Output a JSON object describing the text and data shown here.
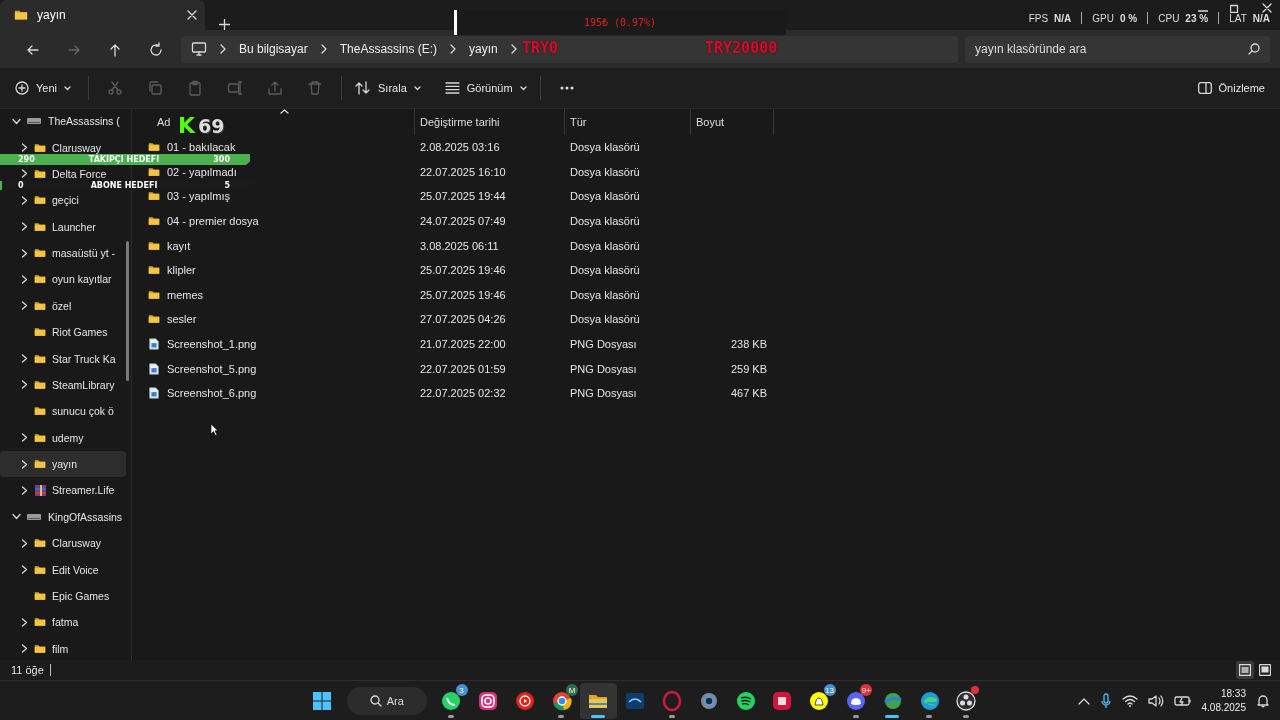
{
  "tab": {
    "title": "yayın",
    "selected": true
  },
  "perf": [
    {
      "label": "FPS",
      "value": "N/A"
    },
    {
      "label": "GPU",
      "value": "0 %"
    },
    {
      "label": "CPU",
      "value": "23 %"
    },
    {
      "label": "LAT",
      "value": "N/A"
    }
  ],
  "nav": [
    {
      "kind": "back",
      "disabled": false
    },
    {
      "kind": "forward",
      "disabled": true
    },
    {
      "kind": "up",
      "disabled": false
    },
    {
      "kind": "refresh",
      "disabled": false
    }
  ],
  "address": {
    "crumbs": [
      "Bu bilgisayar",
      "TheAssassins (E:)",
      "yayın"
    ]
  },
  "search": {
    "placeholder": "yayın klasöründe ara"
  },
  "toolbar": {
    "new": "Yeni",
    "sort": "Sırala",
    "view": "Görünüm",
    "preview": "Önizleme",
    "actions": [
      {
        "kind": "cut",
        "disabled": true
      },
      {
        "kind": "copy",
        "disabled": true
      },
      {
        "kind": "paste",
        "disabled": true
      },
      {
        "kind": "rename",
        "disabled": true
      },
      {
        "kind": "share",
        "disabled": true
      },
      {
        "kind": "delete",
        "disabled": true
      }
    ]
  },
  "sidebar": [
    {
      "label": "TheAssassins (",
      "kind": "drive",
      "expandable": true,
      "expanded": true,
      "selected": false,
      "children": [
        {
          "label": "Clarusway",
          "kind": "folder",
          "expandable": true,
          "expanded": false,
          "selected": false
        },
        {
          "label": "Delta Force",
          "kind": "folder",
          "expandable": true,
          "expanded": false,
          "selected": false
        },
        {
          "label": "geçici",
          "kind": "folder",
          "expandable": true,
          "expanded": false,
          "selected": false
        },
        {
          "label": "Launcher",
          "kind": "folder",
          "expandable": true,
          "expanded": false,
          "selected": false
        },
        {
          "label": "masaüstü yt -",
          "kind": "folder",
          "expandable": true,
          "expanded": false,
          "selected": false
        },
        {
          "label": "oyun kayıtlar",
          "kind": "folder",
          "expandable": true,
          "expanded": false,
          "selected": false
        },
        {
          "label": "özel",
          "kind": "folder",
          "expandable": true,
          "expanded": false,
          "selected": false
        },
        {
          "label": "Riot Games",
          "kind": "folder",
          "expandable": false,
          "selected": false
        },
        {
          "label": "Star Truck Ka",
          "kind": "folder",
          "expandable": true,
          "expanded": false,
          "selected": false
        },
        {
          "label": "SteamLibrary",
          "kind": "folder",
          "expandable": true,
          "expanded": false,
          "selected": false
        },
        {
          "label": "sunucu çok ö",
          "kind": "folder",
          "expandable": false,
          "selected": false
        },
        {
          "label": "udemy",
          "kind": "folder",
          "expandable": true,
          "expanded": false,
          "selected": false
        },
        {
          "label": "yayın",
          "kind": "folder",
          "expandable": true,
          "expanded": false,
          "selected": true
        },
        {
          "label": "Streamer.Life",
          "kind": "archive",
          "expandable": true,
          "expanded": false,
          "selected": false
        }
      ]
    },
    {
      "label": "KingOfAssasins",
      "kind": "drive",
      "expandable": true,
      "expanded": true,
      "selected": false,
      "children": [
        {
          "label": "Clarusway",
          "kind": "folder",
          "expandable": true,
          "expanded": false,
          "selected": false
        },
        {
          "label": "Edit Voice",
          "kind": "folder",
          "expandable": true,
          "expanded": false,
          "selected": false
        },
        {
          "label": "Epic Games",
          "kind": "folder",
          "expandable": false,
          "selected": false
        },
        {
          "label": "fatma",
          "kind": "folder",
          "expandable": true,
          "expanded": false,
          "selected": false
        },
        {
          "label": "film",
          "kind": "folder",
          "expandable": true,
          "expanded": false,
          "selected": false
        }
      ]
    }
  ],
  "table": {
    "columns": [
      "Ad",
      "Değiştirme tarihi",
      "Tür",
      "Boyut"
    ],
    "rows": [
      {
        "kind": "folder",
        "name": "01 - bakılacak",
        "date": "2.08.2025 03:16",
        "type": "Dosya klasörü"
      },
      {
        "kind": "folder",
        "name": "02 - yapılmadı",
        "date": "22.07.2025 16:10",
        "type": "Dosya klasörü"
      },
      {
        "kind": "folder",
        "name": "03 - yapılmış",
        "date": "25.07.2025 19:44",
        "type": "Dosya klasörü"
      },
      {
        "kind": "folder",
        "name": "04 - premier dosya",
        "date": "24.07.2025 07:49",
        "type": "Dosya klasörü"
      },
      {
        "kind": "folder",
        "name": "kayıt",
        "date": "3.08.2025 06:11",
        "type": "Dosya klasörü"
      },
      {
        "kind": "folder",
        "name": "klipler",
        "date": "25.07.2025 19:46",
        "type": "Dosya klasörü"
      },
      {
        "kind": "folder",
        "name": "memes",
        "date": "25.07.2025 19:46",
        "type": "Dosya klasörü"
      },
      {
        "kind": "folder",
        "name": "sesler",
        "date": "27.07.2025 04:26",
        "type": "Dosya klasörü"
      },
      {
        "kind": "image",
        "name": "Screenshot_1.png",
        "date": "21.07.2025 22:00",
        "type": "PNG Dosyası",
        "size": "238 KB"
      },
      {
        "kind": "image",
        "name": "Screenshot_5.png",
        "date": "22.07.2025 01:59",
        "type": "PNG Dosyası",
        "size": "259 KB"
      },
      {
        "kind": "image",
        "name": "Screenshot_6.png",
        "date": "22.07.2025 02:32",
        "type": "PNG Dosyası",
        "size": "467 KB"
      }
    ]
  },
  "status_bar": {
    "count": "11 öğe",
    "views": [
      {
        "kind": "details",
        "selected": true
      },
      {
        "kind": "tiles",
        "selected": false
      }
    ]
  },
  "taskbar": {
    "search": "Ara",
    "apps": [
      {
        "kind": "chat",
        "badge": "3",
        "running": true,
        "selected": false
      },
      {
        "kind": "camera",
        "running": false,
        "selected": false
      },
      {
        "kind": "music",
        "running": false,
        "selected": false
      },
      {
        "kind": "chrome",
        "badge": "M",
        "running": true,
        "selected": false
      },
      {
        "kind": "files",
        "running": true,
        "selected": true
      },
      {
        "kind": "tv",
        "running": false,
        "selected": false
      },
      {
        "kind": "opera",
        "running": true,
        "selected": false
      },
      {
        "kind": "settings",
        "running": false,
        "selected": false
      },
      {
        "kind": "spotify",
        "running": false,
        "selected": false
      },
      {
        "kind": "tile",
        "running": false,
        "selected": false
      },
      {
        "kind": "snap",
        "badge": "13",
        "running": false,
        "selected": false
      },
      {
        "kind": "discord",
        "badge": "9+",
        "running": true,
        "selected": false
      },
      {
        "kind": "globe",
        "running": true,
        "selected": false
      },
      {
        "kind": "edge",
        "running": true,
        "selected": false
      },
      {
        "kind": "obs",
        "alert": true,
        "running": true,
        "selected": false
      }
    ],
    "time": "18:33",
    "date": "4.08.2025"
  },
  "stream_overlay": {
    "viewer_logo": "K",
    "viewers": "69",
    "goals": [
      {
        "current": "290",
        "label": "TAKIPÇI HEDEFI",
        "target": "300",
        "level": 0.97
      },
      {
        "current": "0",
        "label": "ABONE HEDEFİ",
        "target": "5",
        "level": 0
      }
    ],
    "donation": {
      "text": "195₺ (0.97%)",
      "level": 0.0097,
      "start": "TRY0",
      "goal": "TRY20000"
    }
  }
}
